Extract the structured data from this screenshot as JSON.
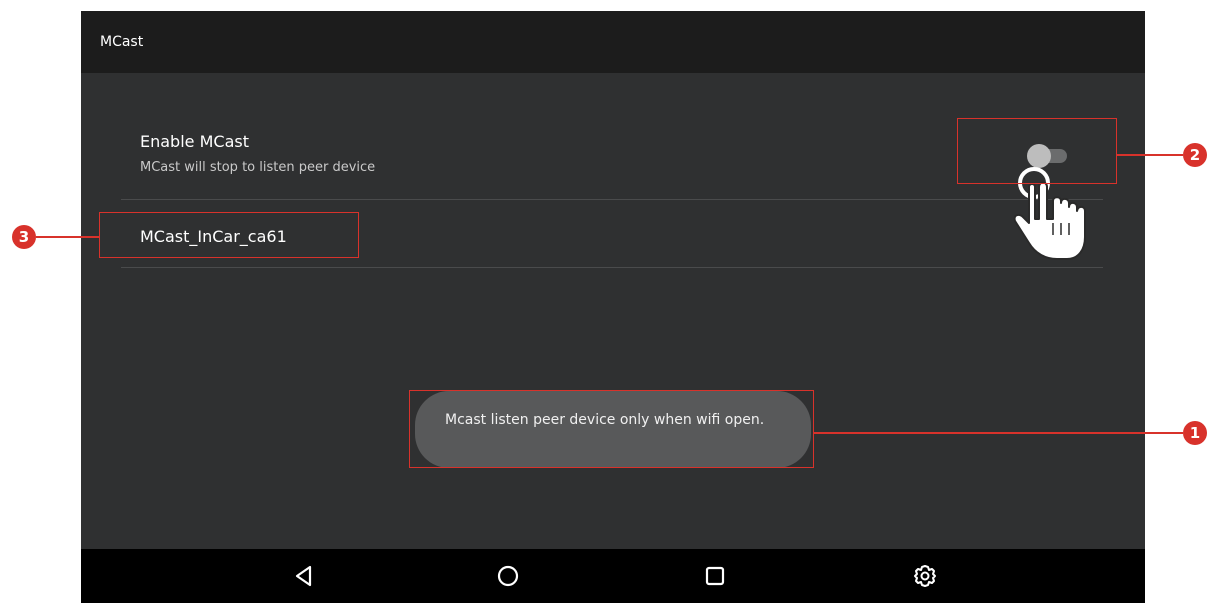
{
  "app": {
    "title": "MCast"
  },
  "preference": {
    "title": "Enable MCast",
    "summary": "MCast will stop to listen peer device",
    "toggle_state": "off"
  },
  "device": {
    "name": "MCast_InCar_ca61"
  },
  "toast": {
    "message": "Mcast listen peer device only when wifi open."
  },
  "navbar": {
    "buttons": [
      "back-icon",
      "home-icon",
      "recents-icon",
      "settings-icon"
    ]
  },
  "callouts": {
    "one": "1",
    "two": "2",
    "three": "3"
  },
  "colors": {
    "callout": "#d8322b",
    "background": "#2f3031",
    "titlebar": "#1c1c1c",
    "navbar": "#000000"
  }
}
